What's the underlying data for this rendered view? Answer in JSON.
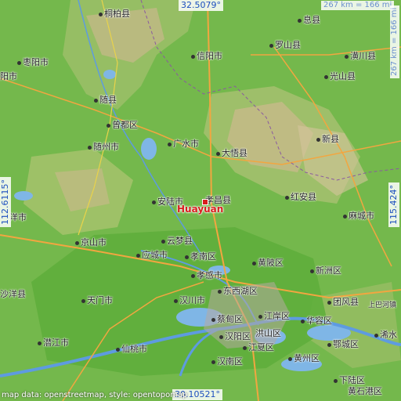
{
  "map": {
    "featured_place": "Huayuan",
    "coordinates": {
      "top_lat": "32.5079°",
      "bottom_lat": "30.10521°",
      "left_lon": "112.6115°",
      "right_lon": "115.424°"
    },
    "scale": {
      "horizontal": "267 km = 166 mi",
      "vertical": "267 km = 166 mi"
    },
    "credit": "map data: openstreetmap, style: opentopomap",
    "places": [
      {
        "name": "桐柏县"
      },
      {
        "name": "息县"
      },
      {
        "name": "枣阳市"
      },
      {
        "name": "信阳市"
      },
      {
        "name": "罗山县"
      },
      {
        "name": "潢川县"
      },
      {
        "name": "阳市"
      },
      {
        "name": "光山县"
      },
      {
        "name": "随县"
      },
      {
        "name": "曾都区"
      },
      {
        "name": "随州市"
      },
      {
        "name": "广水市"
      },
      {
        "name": "大悟县"
      },
      {
        "name": "新县"
      },
      {
        "name": "安陆市"
      },
      {
        "name": "孝昌县"
      },
      {
        "name": "红安县"
      },
      {
        "name": "麻城市"
      },
      {
        "name": "洋市"
      },
      {
        "name": "京山市"
      },
      {
        "name": "云梦县"
      },
      {
        "name": "应城市"
      },
      {
        "name": "孝南区"
      },
      {
        "name": "黄陂区"
      },
      {
        "name": "新洲区"
      },
      {
        "name": "孝感市"
      },
      {
        "name": "沙洋县"
      },
      {
        "name": "天门市"
      },
      {
        "name": "汉川市"
      },
      {
        "name": "东西湖区"
      },
      {
        "name": "团风县"
      },
      {
        "name": "上巴河镇"
      },
      {
        "name": "蔡甸区"
      },
      {
        "name": "江岸区"
      },
      {
        "name": "华容区"
      },
      {
        "name": "潜江市"
      },
      {
        "name": "仙桃市"
      },
      {
        "name": "汉阳区"
      },
      {
        "name": "江夏区"
      },
      {
        "name": "洪山区"
      },
      {
        "name": "鄂城区"
      },
      {
        "name": "浠水"
      },
      {
        "name": "汉南区"
      },
      {
        "name": "黄州区"
      },
      {
        "name": "下陆区"
      },
      {
        "name": "黄石港区"
      }
    ]
  }
}
